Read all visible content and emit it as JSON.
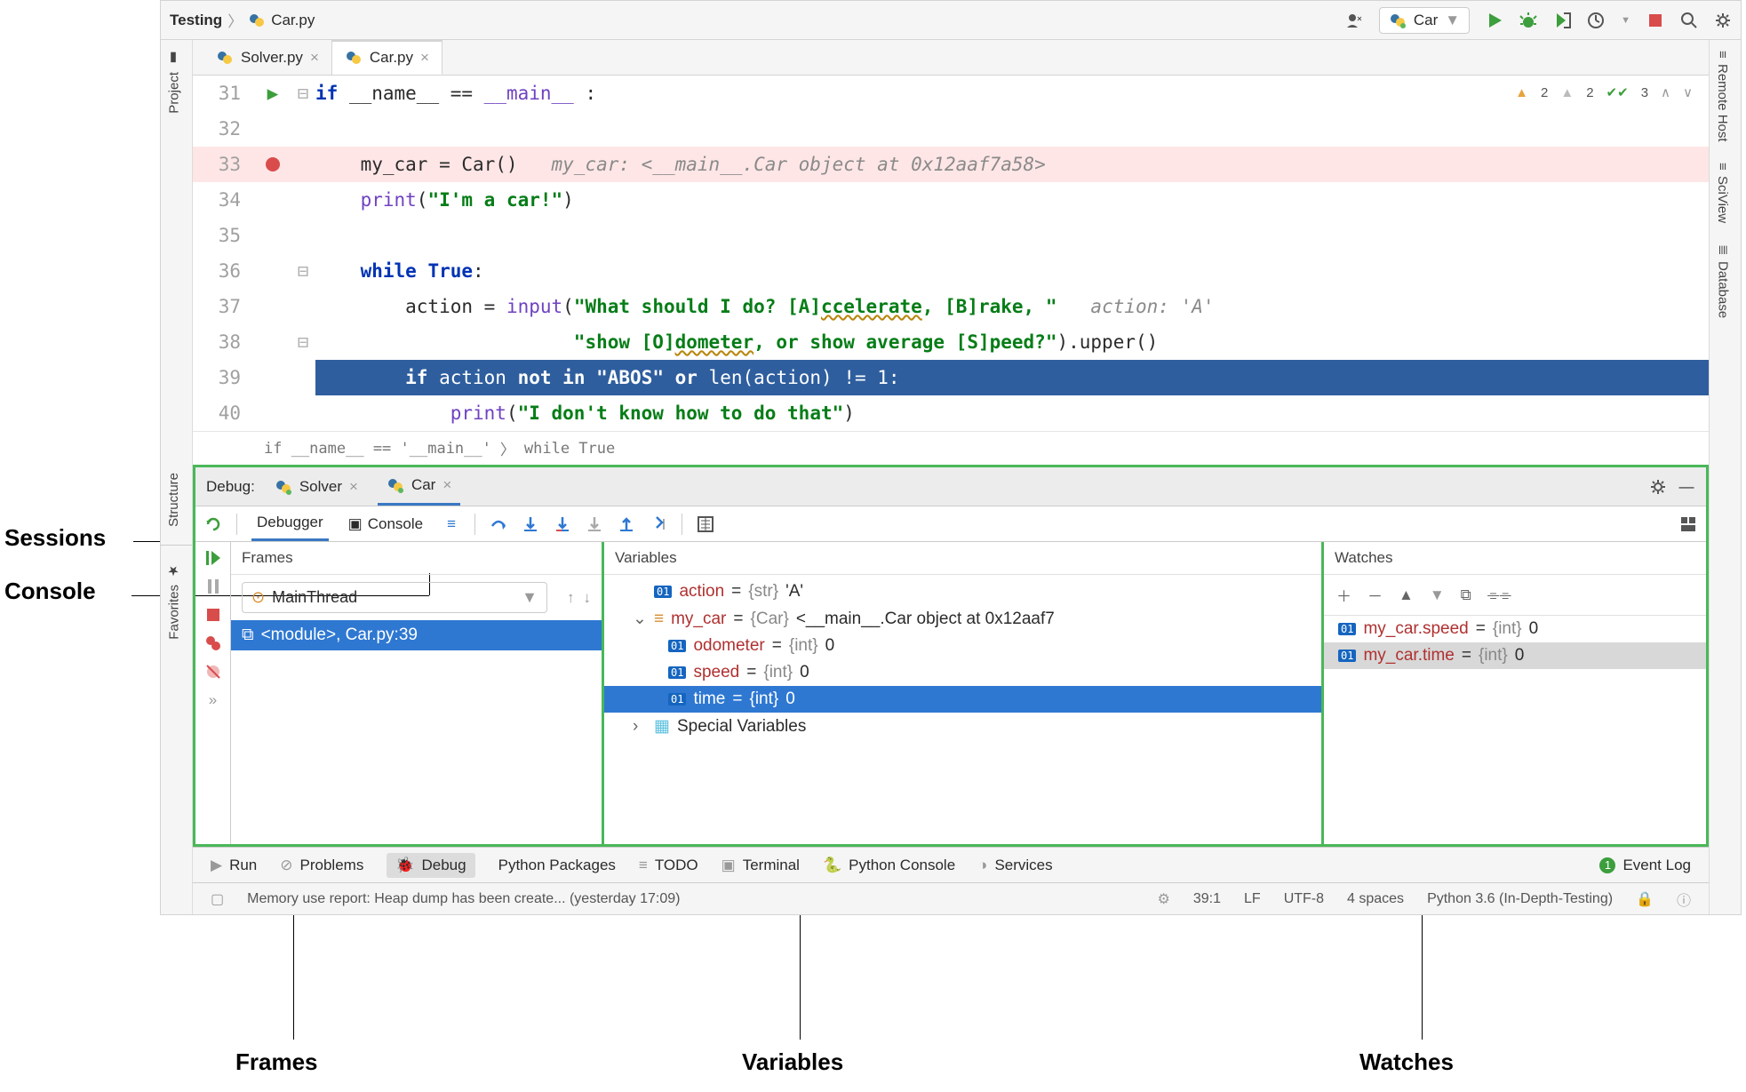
{
  "breadcrumb": {
    "project": "Testing",
    "file": "Car.py"
  },
  "run_config": "Car",
  "editor_tabs": [
    {
      "name": "Solver.py",
      "active": false
    },
    {
      "name": "Car.py",
      "active": true
    }
  ],
  "inspections": {
    "err": "2",
    "weak": "2",
    "typo": "3"
  },
  "code_lines": [
    {
      "n": "31",
      "gutter": "run-gutter-icon",
      "fold": "⊟",
      "hl": "",
      "html_key": "l31"
    },
    {
      "n": "32",
      "gutter": "",
      "fold": "",
      "hl": "",
      "html_key": "l32"
    },
    {
      "n": "33",
      "gutter": "breakpoint",
      "fold": "",
      "hl": "hl-pink",
      "html_key": "l33"
    },
    {
      "n": "34",
      "gutter": "",
      "fold": "",
      "hl": "",
      "html_key": "l34"
    },
    {
      "n": "35",
      "gutter": "",
      "fold": "",
      "hl": "",
      "html_key": "l35"
    },
    {
      "n": "36",
      "gutter": "",
      "fold": "⊟",
      "hl": "",
      "html_key": "l36"
    },
    {
      "n": "37",
      "gutter": "",
      "fold": "",
      "hl": "",
      "html_key": "l37"
    },
    {
      "n": "38",
      "gutter": "",
      "fold": "⊟",
      "hl": "",
      "html_key": "l38"
    },
    {
      "n": "39",
      "gutter": "",
      "fold": "",
      "hl": "hl-blue",
      "html_key": "l39"
    },
    {
      "n": "40",
      "gutter": "",
      "fold": "",
      "hl": "",
      "html_key": "l40"
    }
  ],
  "code_crumbs": [
    "if __name__ == '__main__'",
    "while True"
  ],
  "left_tools": [
    "Project",
    "Structure",
    "Favorites"
  ],
  "right_tools": [
    "Remote Host",
    "SciView",
    "Database"
  ],
  "debug": {
    "label": "Debug:",
    "sessions": [
      {
        "name": "Solver",
        "active": false
      },
      {
        "name": "Car",
        "active": true
      }
    ],
    "views": [
      {
        "name": "Debugger",
        "active": true
      },
      {
        "name": "Console",
        "active": false
      }
    ],
    "frames_title": "Frames",
    "thread": "MainThread",
    "frame": "<module>, Car.py:39",
    "vars_title": "Variables",
    "variables": [
      {
        "kind": "val",
        "name": "action",
        "type": "{str}",
        "value": "'A'",
        "depth": 0
      },
      {
        "kind": "obj",
        "name": "my_car",
        "type": "{Car}",
        "value": "<__main__.Car object at 0x12aaf7",
        "depth": 0,
        "expanded": true
      },
      {
        "kind": "val",
        "name": "odometer",
        "type": "{int}",
        "value": "0",
        "depth": 1
      },
      {
        "kind": "val",
        "name": "speed",
        "type": "{int}",
        "value": "0",
        "depth": 1
      },
      {
        "kind": "val",
        "name": "time",
        "type": "{int}",
        "value": "0",
        "depth": 1,
        "sel": true
      },
      {
        "kind": "special",
        "name": "Special Variables",
        "depth": 0
      }
    ],
    "watches_title": "Watches",
    "watches": [
      {
        "name": "my_car.speed",
        "type": "{int}",
        "value": "0"
      },
      {
        "name": "my_car.time",
        "type": "{int}",
        "value": "0",
        "sel": true
      }
    ]
  },
  "tool_tabs": [
    "Run",
    "Problems",
    "Debug",
    "Python Packages",
    "TODO",
    "Terminal",
    "Python Console",
    "Services",
    "Event Log"
  ],
  "event_badge": "1",
  "status": {
    "msg": "Memory use report: Heap dump has been create... (yesterday 17:09)",
    "pos": "39:1",
    "eol": "LF",
    "enc": "UTF-8",
    "indent": "4 spaces",
    "sdk": "Python 3.6 (In-Depth-Testing)"
  },
  "annotations": {
    "sessions": "Sessions",
    "console": "Console",
    "frames": "Frames",
    "variables": "Variables",
    "watches": "Watches"
  },
  "code": {
    "l31_1": "if",
    "l31_2": " __name__ == ",
    "l31_3": "__main__",
    "l31_4": " :",
    "l33_1": "    my_car = Car()   ",
    "l33_2": "my_car: <__main__.Car object at 0x12aaf7a58>",
    "l34_1": "    ",
    "l34_2": "print",
    "l34_3": "(",
    "l34_4": "\"I'm a car!\"",
    "l34_5": ")",
    "l36_1": "    ",
    "l36_2": "while",
    "l36_3": " ",
    "l36_4": "True",
    "l36_5": ":",
    "l37_1": "        action = ",
    "l37_2": "input",
    "l37_3": "(",
    "l37_4": "\"What should I do? [A]",
    "l37_5": "ccelerate",
    "l37_6": ", [B]rake, \"",
    "l37_7": "   ",
    "l37_8": "action: 'A'",
    "l38_1": "                       ",
    "l38_2": "\"show [O]",
    "l38_3": "dometer",
    "l38_4": ", or show average [S]peed?\"",
    "l38_5": ").upper()",
    "l39_1": "        ",
    "l39_2": "if",
    "l39_3": " action ",
    "l39_4": "not in",
    "l39_5": " ",
    "l39_6": "\"ABOS\"",
    "l39_7": " ",
    "l39_8": "or",
    "l39_9": " ",
    "l39_10": "len",
    "l39_11": "(action) != ",
    "l39_12": "1",
    "l39_13": ":",
    "l40_1": "            ",
    "l40_2": "print",
    "l40_3": "(",
    "l40_4": "\"I don't know how to do that\"",
    "l40_5": ")"
  }
}
